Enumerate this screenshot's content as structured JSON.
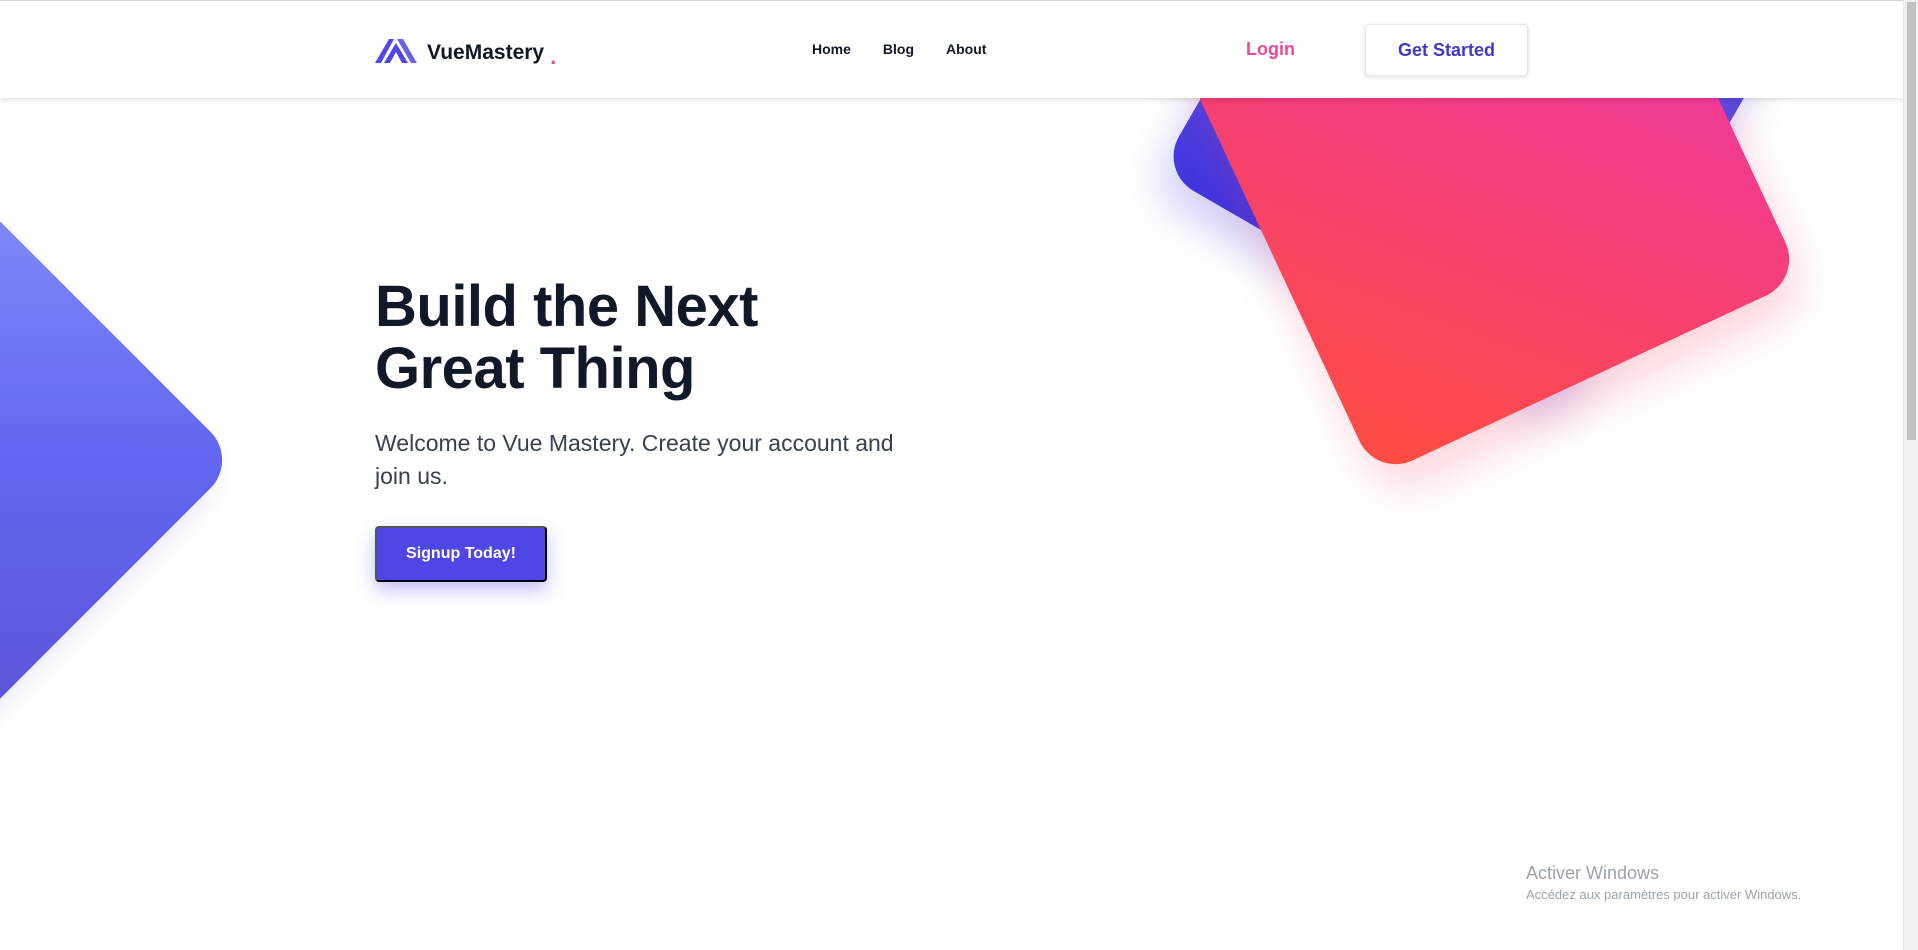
{
  "navbar": {
    "brand": "VueMastery",
    "brand_dot": ".",
    "links": [
      {
        "label": "Home"
      },
      {
        "label": "Blog"
      },
      {
        "label": "About"
      }
    ],
    "login_label": "Login",
    "get_started_label": "Get Started"
  },
  "hero": {
    "title_line1": "Build the Next",
    "title_line2": "Great Thing",
    "subtitle": "Welcome to Vue Mastery. Create your account and join us.",
    "cta_label": "Signup Today!"
  },
  "watermark": {
    "title": "Activer Windows",
    "subtitle": "Accédez aux paramètres pour activer Windows."
  },
  "icons": {
    "logo": "vuemastery-logo-icon"
  },
  "colors": {
    "primary": "#4f46e5",
    "accent_pink": "#ec4899",
    "heading": "#111827",
    "body_text": "#374151"
  }
}
